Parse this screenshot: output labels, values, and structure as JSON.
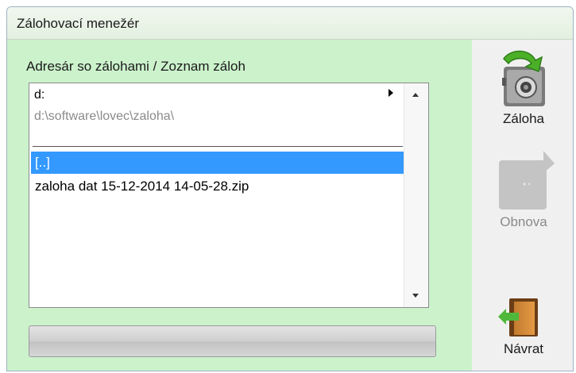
{
  "window": {
    "title": "Zálohovací menežér"
  },
  "backup_list": {
    "label": "Adresár so zálohami / Zoznam záloh",
    "drive": "d:",
    "path": "d:\\software\\lovec\\zaloha\\",
    "items": [
      {
        "name": "[..]",
        "selected": true
      },
      {
        "name": "zaloha dat 15-12-2014 14-05-28.zip",
        "selected": false
      }
    ]
  },
  "progress": {
    "percent": 0
  },
  "toolbar": {
    "backup_label": "Záloha",
    "restore_label": "Obnova",
    "back_label": "Návrat"
  },
  "colors": {
    "panel_bg": "#ccf2cc",
    "selection": "#3399ff",
    "backup_arrow": "#4caf28"
  },
  "icons": {
    "backup": "safe-with-arrow-icon",
    "restore": "restore-arrow-icon",
    "back": "exit-door-icon"
  }
}
